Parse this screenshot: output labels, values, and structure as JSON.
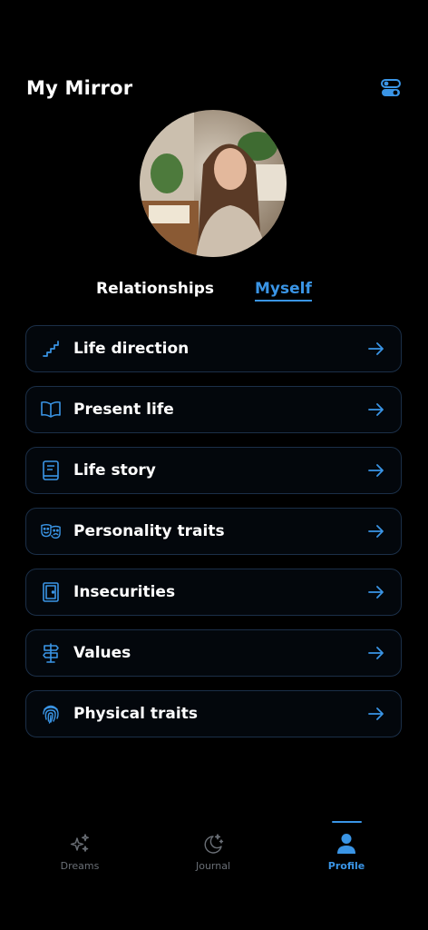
{
  "header": {
    "title": "My Mirror",
    "settings_icon": "toggle-settings-icon"
  },
  "profile": {
    "avatar_alt": "profile photo"
  },
  "tabs": [
    {
      "label": "Relationships",
      "active": false
    },
    {
      "label": "Myself",
      "active": true
    }
  ],
  "items": [
    {
      "label": "Life direction",
      "icon": "stairs-icon"
    },
    {
      "label": "Present life",
      "icon": "open-book-icon"
    },
    {
      "label": "Life story",
      "icon": "book-icon"
    },
    {
      "label": "Personality traits",
      "icon": "theater-masks-icon"
    },
    {
      "label": "Insecurities",
      "icon": "door-icon"
    },
    {
      "label": "Values",
      "icon": "signpost-icon"
    },
    {
      "label": "Physical traits",
      "icon": "fingerprint-icon"
    }
  ],
  "nav": [
    {
      "label": "Dreams",
      "icon": "sparkles-icon",
      "active": false
    },
    {
      "label": "Journal",
      "icon": "moon-stars-icon",
      "active": false
    },
    {
      "label": "Profile",
      "icon": "person-icon",
      "active": true
    }
  ],
  "colors": {
    "accent": "#3a95e6",
    "background": "#000000",
    "card_border": "#1b2f48",
    "inactive_nav": "#6a6f76"
  }
}
